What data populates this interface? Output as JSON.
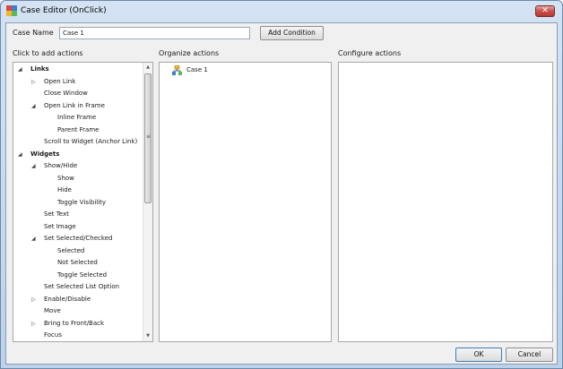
{
  "window": {
    "title": "Case Editor (OnClick)",
    "close_label": "✕"
  },
  "case_name": {
    "label": "Case Name",
    "value": "Case 1"
  },
  "add_condition_label": "Add Condition",
  "columns": {
    "add_actions": "Click to add actions",
    "organize_actions": "Organize actions",
    "configure_actions": "Configure actions"
  },
  "action_tree": [
    {
      "label": "Links",
      "bold": true,
      "expander": "expanded",
      "level": 0
    },
    {
      "label": "Open Link",
      "bold": false,
      "expander": "collapsed",
      "level": 1
    },
    {
      "label": "Close Window",
      "bold": false,
      "expander": "none",
      "level": 1
    },
    {
      "label": "Open Link in Frame",
      "bold": false,
      "expander": "expanded",
      "level": 1
    },
    {
      "label": "Inline Frame",
      "bold": false,
      "expander": "none",
      "level": 2
    },
    {
      "label": "Parent Frame",
      "bold": false,
      "expander": "none",
      "level": 2
    },
    {
      "label": "Scroll to Widget (Anchor Link)",
      "bold": false,
      "expander": "none",
      "level": 1
    },
    {
      "label": "Widgets",
      "bold": true,
      "expander": "expanded",
      "level": 0
    },
    {
      "label": "Show/Hide",
      "bold": false,
      "expander": "expanded",
      "level": 1
    },
    {
      "label": "Show",
      "bold": false,
      "expander": "none",
      "level": 2
    },
    {
      "label": "Hide",
      "bold": false,
      "expander": "none",
      "level": 2
    },
    {
      "label": "Toggle Visibility",
      "bold": false,
      "expander": "none",
      "level": 2
    },
    {
      "label": "Set Text",
      "bold": false,
      "expander": "none",
      "level": 1
    },
    {
      "label": "Set Image",
      "bold": false,
      "expander": "none",
      "level": 1
    },
    {
      "label": "Set Selected/Checked",
      "bold": false,
      "expander": "expanded",
      "level": 1
    },
    {
      "label": "Selected",
      "bold": false,
      "expander": "none",
      "level": 2
    },
    {
      "label": "Not Selected",
      "bold": false,
      "expander": "none",
      "level": 2
    },
    {
      "label": "Toggle Selected",
      "bold": false,
      "expander": "none",
      "level": 2
    },
    {
      "label": "Set Selected List Option",
      "bold": false,
      "expander": "none",
      "level": 1
    },
    {
      "label": "Enable/Disable",
      "bold": false,
      "expander": "collapsed",
      "level": 1
    },
    {
      "label": "Move",
      "bold": false,
      "expander": "none",
      "level": 1
    },
    {
      "label": "Bring to Front/Back",
      "bold": false,
      "expander": "collapsed",
      "level": 1
    },
    {
      "label": "Focus",
      "bold": false,
      "expander": "none",
      "level": 1
    }
  ],
  "organize": {
    "case_label": "Case 1",
    "case_icon": "case-tree-icon"
  },
  "buttons": {
    "ok": "OK",
    "cancel": "Cancel"
  },
  "colors": {
    "titlebar": "#c9dbef",
    "close": "#c75050",
    "client_bg": "#f0f0f0"
  }
}
